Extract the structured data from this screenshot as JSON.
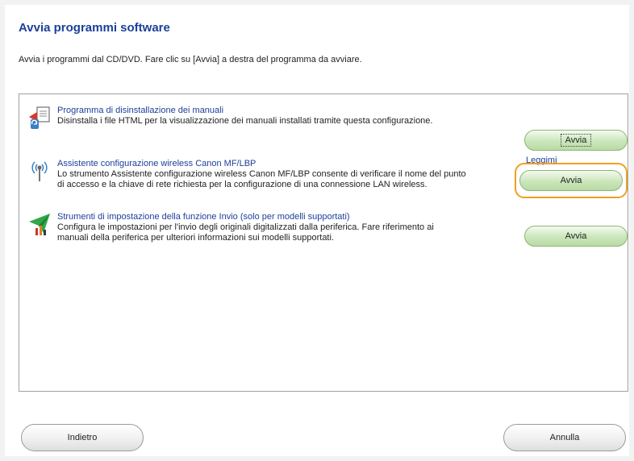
{
  "header": {
    "title": "Avvia programmi software",
    "instructions": "Avvia i programmi dal CD/DVD. Fare clic su [Avvia] a destra del programma da avviare."
  },
  "programs": [
    {
      "title": "Programma di disinstallazione dei manuali",
      "description": [
        "Disinstalla i file HTML per la visualizzazione dei manuali installati tramite questa configurazione."
      ],
      "button_label": "Avvia",
      "icon": "uninstall-manuals-icon"
    },
    {
      "title": "Assistente configurazione wireless Canon MF/LBP",
      "description": [
        "Lo strumento Assistente configurazione wireless Canon MF/LBP consente di verificare il nome del punto",
        "di accesso e la chiave di rete richiesta per la configurazione di una connessione LAN wireless."
      ],
      "link_label": "Leggimi",
      "button_label": "Avvia",
      "icon": "wireless-antenna-icon"
    },
    {
      "title": "Strumenti di impostazione della funzione Invio (solo per modelli supportati)",
      "description": [
        "Configura le impostazioni per l'invio degli originali digitalizzati dalla periferica. Fare riferimento ai",
        "manuali della periferica per ulteriori informazioni sui modelli supportati."
      ],
      "button_label": "Avvia",
      "icon": "send-settings-icon"
    }
  ],
  "footer": {
    "back_label": "Indietro",
    "cancel_label": "Annulla"
  },
  "colors": {
    "title": "#1d3f9a",
    "highlight": "#f0a020",
    "button_green": "#cbe6bb"
  }
}
